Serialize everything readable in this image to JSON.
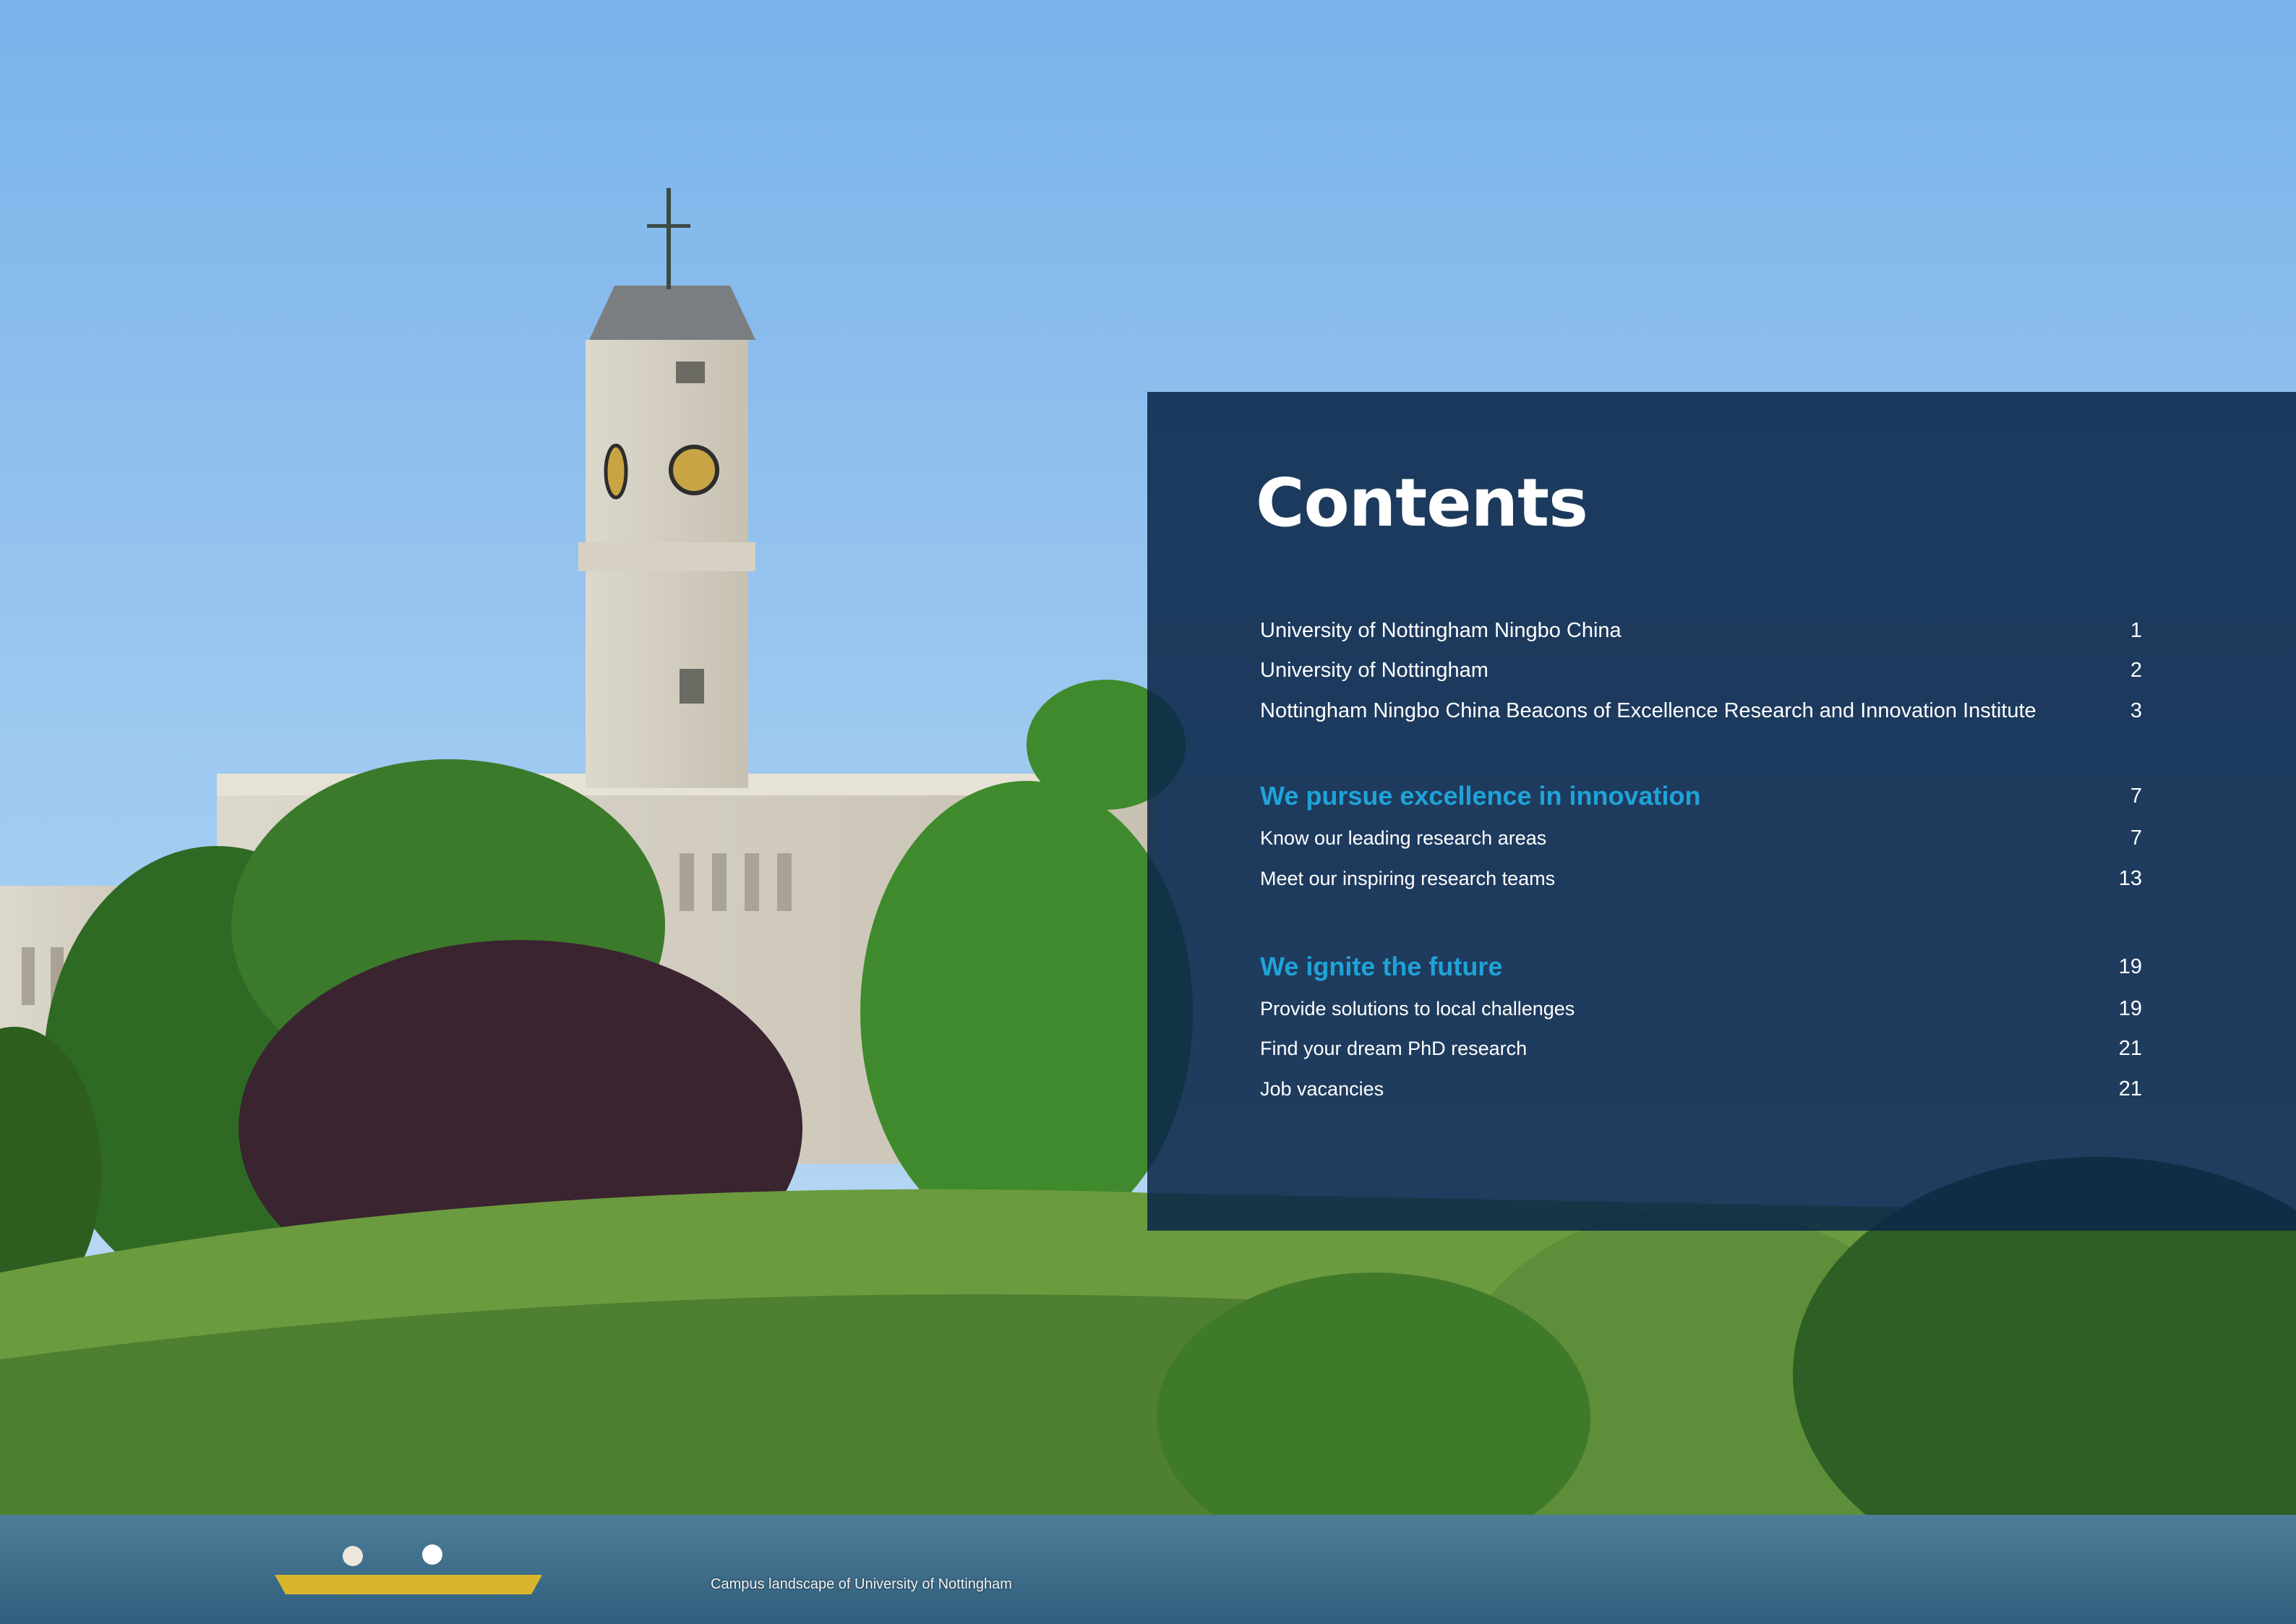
{
  "contents": {
    "title": "Contents",
    "entries": [
      {
        "label": "University of Nottingham Ningbo China",
        "page": "1"
      },
      {
        "label": "University of Nottingham",
        "page": "2"
      },
      {
        "label": "Nottingham Ningbo China Beacons of Excellence Research and Innovation Institute",
        "page": "3"
      }
    ],
    "section1": {
      "heading": "We pursue excellence in innovation",
      "page": "7",
      "items": [
        {
          "label": "Know our leading research areas",
          "page": "7"
        },
        {
          "label": "Meet our inspiring research teams",
          "page": "13"
        }
      ]
    },
    "section2": {
      "heading": "We ignite the future",
      "page": "19",
      "items": [
        {
          "label": "Provide solutions to local challenges",
          "page": "19"
        },
        {
          "label": "Find your dream PhD research",
          "page": "21"
        },
        {
          "label": "Job vacancies",
          "page": "21"
        }
      ]
    }
  },
  "caption": "Campus landscape of University of Nottingham",
  "colors": {
    "panel": "#0b2749",
    "accent": "#1fa3d8",
    "text": "#ffffff"
  }
}
